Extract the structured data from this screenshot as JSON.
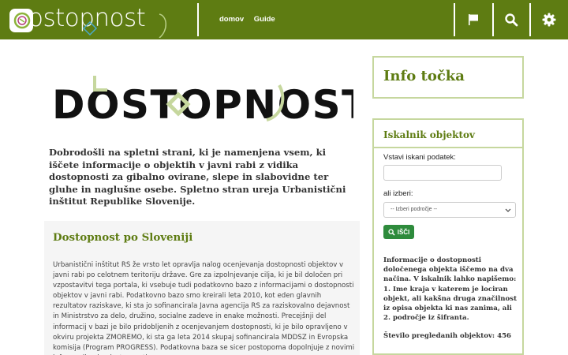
{
  "header": {
    "logo_text": "ostopnost",
    "nav": [
      {
        "label": "domov"
      },
      {
        "label": "Guide"
      }
    ],
    "icons": [
      "flag-icon",
      "search-icon",
      "gear-icon"
    ]
  },
  "hero": {
    "logo_text": "DOSTOPNOST"
  },
  "intro": "Dobrodošli na spletni strani, ki je namenjena vsem, ki iščete informacije o objektih v javni rabi z vidika dostopnosti za gibalno ovirane, slepe in slabovidne ter gluhe in naglušne osebe. Spletno stran ureja Urbanistični inštitut Republike Slovenije.",
  "panel": {
    "title": "Dostopnost po Sloveniji",
    "body": "Urbanistični inštitut RS že vrsto let opravlja nalog ocenjevanja dostopnosti objektov v javni rabi po celotnem teritoriju države. Gre za izpolnjevanje cilja, ki je bil določen pri vzpostavitvi tega portala, ki vsebuje tudi podatkovno bazo z informacijami o dostopnosti objektov v javni rabi. Podatkovno bazo smo kreirali leta 2010, kot eden glavnih rezultatov raziskave, ki sta jo sofinancirala Javna agencija RS za raziskovalno dejavnost in Ministrstvo za delo, družino, socialne zadeve in enake možnosti. Precejšnji del informacij v bazi je bilo pridobljenih z ocenjevanjem dostopnosti, ki je bilo opravljeno v okviru projekta ZMOREMO, ki sta ga leta 2014 skupaj sofinancirala MDDSZ in Evropska komisija (Program PROGRESS). Podatkovna baza se sicer postopoma dopolnjuje z novimi informacijami o dostopnosti"
  },
  "sidebar": {
    "info_title": "Info točka",
    "search_title": "Iskalnik objektov",
    "input_label": "Vstavi iskani podatek:",
    "input_value": "",
    "select_label": "ali izberi:",
    "select_value": "-- Izberi področje --",
    "button_label": "IŠČI",
    "info_text": "Informacije o dostopnosti določenega objekta iščemo na dva načina. V iskalnik lahko napišemo: 1. Ime kraja v katerem je lociran objekt, ali kakšna druga značilnost iz opisa objekta ki nas zanima, ali 2. področje iz šifranta.",
    "count_text": "Število pregledanih objektov: 456"
  },
  "colors": {
    "brand_green": "#5e7c12",
    "light_green": "#c6d79e",
    "button_green": "#2e8b3c"
  }
}
